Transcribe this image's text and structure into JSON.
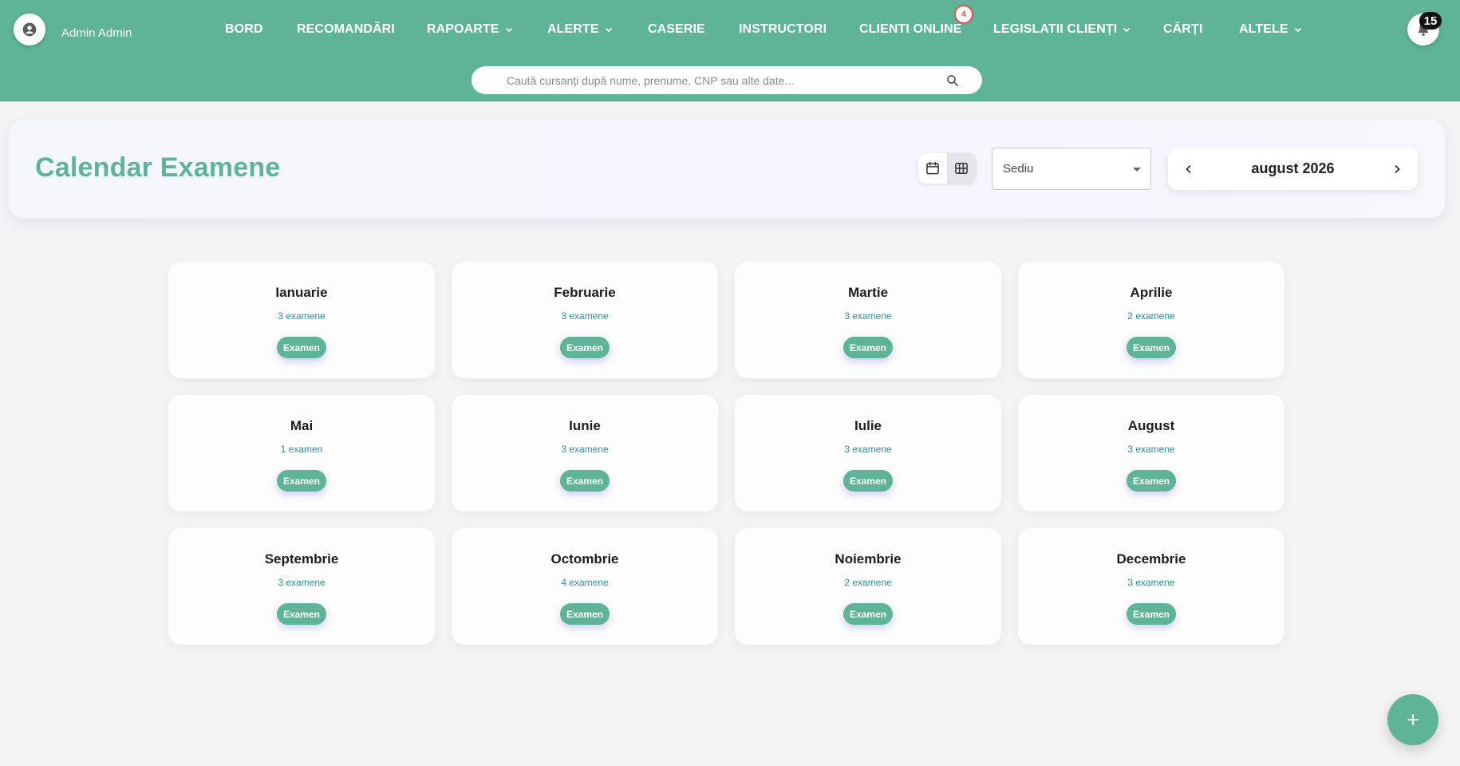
{
  "header": {
    "user_name": "Admin Admin",
    "nav": [
      {
        "label": "BORD",
        "dropdown": false
      },
      {
        "label": "RECOMANDĂRI",
        "dropdown": false
      },
      {
        "label": "RAPOARTE",
        "dropdown": true
      },
      {
        "label": "ALERTE",
        "dropdown": true
      },
      {
        "label": "CASERIE",
        "dropdown": false
      },
      {
        "label": "INSTRUCTORI",
        "dropdown": false
      },
      {
        "label": "CLIENTI ONLINE",
        "dropdown": false
      },
      {
        "label": "LEGISLATII CLIENȚI",
        "dropdown": true
      },
      {
        "label": "CĂRȚI",
        "dropdown": false
      },
      {
        "label": "ALTELE",
        "dropdown": true
      }
    ],
    "clients_online_badge": "4",
    "notifications_count": "15",
    "search": {
      "placeholder": "Caută cursanți după nume, prenume, CNP sau alte date...",
      "value": ""
    }
  },
  "calendar": {
    "title": "Calendar Examene",
    "branch_select": "Sediu",
    "current_month": "august 2026",
    "months": [
      {
        "name": "Ianuarie",
        "count": "3 examene",
        "tag": "Examen"
      },
      {
        "name": "Februarie",
        "count": "3 examene",
        "tag": "Examen"
      },
      {
        "name": "Martie",
        "count": "3 examene",
        "tag": "Examen"
      },
      {
        "name": "Aprilie",
        "count": "2 examene",
        "tag": "Examen"
      },
      {
        "name": "Mai",
        "count": "1 examen",
        "tag": "Examen"
      },
      {
        "name": "Iunie",
        "count": "3 examene",
        "tag": "Examen"
      },
      {
        "name": "Iulie",
        "count": "3 examene",
        "tag": "Examen"
      },
      {
        "name": "August",
        "count": "3 examene",
        "tag": "Examen"
      },
      {
        "name": "Septembrie",
        "count": "3 examene",
        "tag": "Examen"
      },
      {
        "name": "Octombrie",
        "count": "4 examene",
        "tag": "Examen"
      },
      {
        "name": "Noiembrie",
        "count": "2 examene",
        "tag": "Examen"
      },
      {
        "name": "Decembrie",
        "count": "3 examene",
        "tag": "Examen"
      }
    ]
  },
  "fab_label": "+",
  "colors": {
    "brand": "#5fb396",
    "title": "#5fb396",
    "count_text": "#2f8f9a",
    "badge_ring": "#d9534f"
  }
}
